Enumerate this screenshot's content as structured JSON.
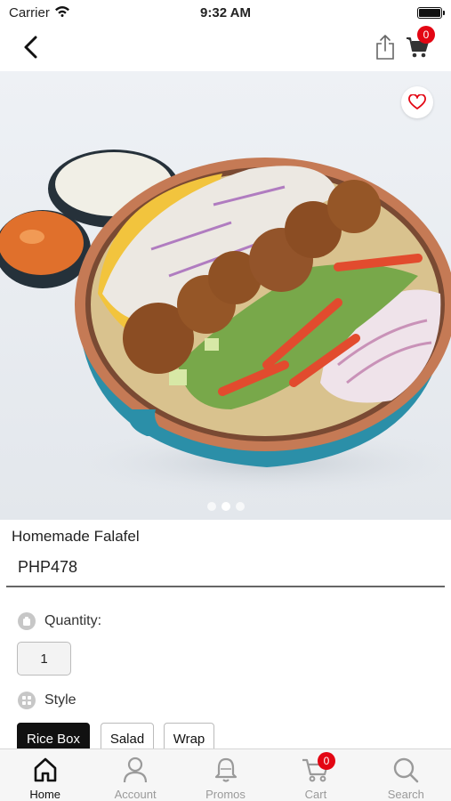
{
  "status_bar": {
    "carrier": "Carrier",
    "time": "9:32 AM"
  },
  "nav": {
    "cart_count": "0",
    "icons": [
      "back-arrow-icon",
      "share-icon",
      "cart-icon"
    ]
  },
  "hero": {
    "image_description": "falafel rice bowl",
    "carousel_pages": 3,
    "active_page": 2
  },
  "product": {
    "name": "Homemade Falafel",
    "price": "PHP478"
  },
  "quantity": {
    "label": "Quantity:",
    "value": "1"
  },
  "style": {
    "label": "Style",
    "options": [
      "Rice Box",
      "Salad",
      "Wrap"
    ],
    "selected": "Rice Box"
  },
  "tab_bar": {
    "tabs": [
      {
        "label": "Home",
        "icon": "home-icon",
        "active": true
      },
      {
        "label": "Account",
        "icon": "user-icon",
        "active": false
      },
      {
        "label": "Promos",
        "icon": "bell-icon",
        "active": false
      },
      {
        "label": "Cart",
        "icon": "cart-icon",
        "active": false,
        "badge": "0"
      },
      {
        "label": "Search",
        "icon": "search-icon",
        "active": false
      }
    ]
  },
  "colors": {
    "badge": "#e30613",
    "selected_style": "#111111",
    "divider": "#666666",
    "bowl": "#2b8fa8"
  }
}
